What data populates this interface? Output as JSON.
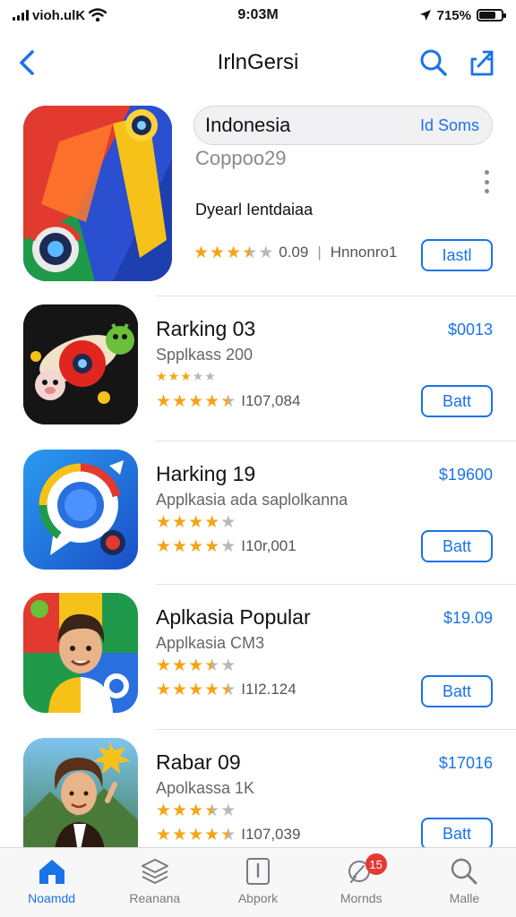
{
  "status_bar": {
    "carrier": "vioh.ulK",
    "time": "9:03M",
    "battery": "715%",
    "battery_level": 0.75
  },
  "nav": {
    "title": "IrlnGersi",
    "back_icon": "chevron-left-icon",
    "search_icon": "search-icon",
    "share_icon": "share-icon"
  },
  "featured": {
    "pill_title": "Indonesia",
    "pill_link": "Id Soms",
    "subtitle": "Coppoo29",
    "description": "Dyearl Ientdaiaa",
    "rating": 3.5,
    "rating_count": "0.09",
    "developer": "Hnnonro1",
    "get_label": "Iastl"
  },
  "apps": [
    {
      "title": "Rarking 03",
      "subtitle": "Spplkass 200",
      "rating_small": 3,
      "rating": 4.5,
      "rating_count": "I107,084",
      "price": "$0013",
      "get_label": "Batt"
    },
    {
      "title": "Harking 19",
      "subtitle": "Applkasia ada saplolkanna",
      "rating_small": 4,
      "rating": 4,
      "rating_count": "I10r,001",
      "price": "$19600",
      "get_label": "Batt"
    },
    {
      "title": "Aplkasia Popular",
      "subtitle": "Applkasia CM3",
      "rating_small": 3.5,
      "rating": 4.5,
      "rating_count": "I1I2.124",
      "price": "$19.09",
      "get_label": "Batt"
    },
    {
      "title": "Rabar 09",
      "subtitle": "Apolkassa 1K",
      "rating_small": 3.5,
      "rating": 4.5,
      "rating_count": "I107,039",
      "price": "$17016",
      "get_label": "Batt"
    }
  ],
  "tabs": [
    {
      "label": "Noamdd",
      "icon": "home-icon",
      "active": true
    },
    {
      "label": "Reanana",
      "icon": "stack-icon",
      "active": false
    },
    {
      "label": "Abpork",
      "icon": "book-icon",
      "active": false
    },
    {
      "label": "Mornds",
      "icon": "rocket-icon",
      "active": false,
      "badge": "15"
    },
    {
      "label": "Malle",
      "icon": "search-icon",
      "active": false
    }
  ],
  "colors": {
    "accent": "#1a73e8",
    "star": "#f4a416",
    "badge": "#e53935"
  }
}
